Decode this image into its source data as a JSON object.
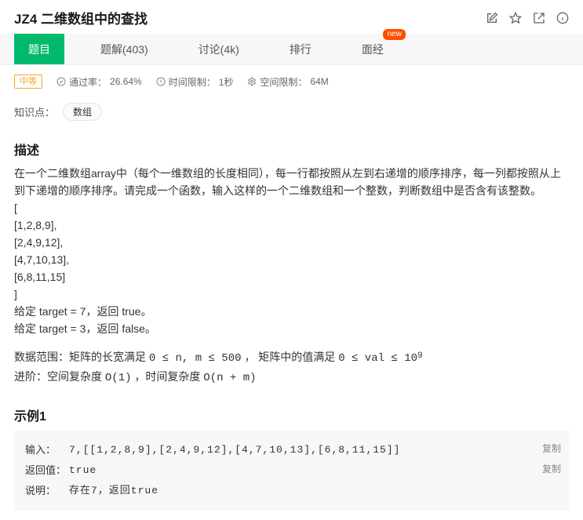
{
  "header": {
    "title": "JZ4 二维数组中的查找"
  },
  "tabs": {
    "problem": "题目",
    "solutions": "题解(403)",
    "discuss": "讨论(4k)",
    "rank": "排行",
    "interview": "面经",
    "new_badge": "new"
  },
  "meta": {
    "difficulty": "中等",
    "pass_rate_label": "通过率：",
    "pass_rate_value": "26.64%",
    "time_limit_label": "时间限制：",
    "time_limit_value": "1秒",
    "mem_limit_label": "空间限制：",
    "mem_limit_value": "64M"
  },
  "kp": {
    "label": "知识点：",
    "tag": "数组"
  },
  "description": {
    "heading": "描述",
    "para": "在一个二维数组array中（每个一维数组的长度相同），每一行都按照从左到右递增的顺序排序，每一列都按照从上到下递增的顺序排序。请完成一个函数，输入这样的一个二维数组和一个整数，判断数组中是否含有该整数。",
    "matrix_lines": [
      "[",
      "[1,2,8,9],",
      "[2,4,9,12],",
      "[4,7,10,13],",
      "[6,8,11,15]",
      "]"
    ],
    "target_line1": "给定 target = 7，返回 true。",
    "target_line2": "给定 target = 3，返回 false。",
    "range_prefix": "数据范围：矩阵的长宽满足 ",
    "range_eq1": "0 ≤ n, m ≤ 500",
    "range_mid": " ， 矩阵中的值满足 ",
    "range_eq2_base": "0 ≤ val ≤ 10",
    "range_eq2_sup": "9",
    "adv_prefix": "进阶：空间复杂度 ",
    "adv_o1": "O(1)",
    "adv_mid": " ，时间复杂度 ",
    "adv_onm": "O(n + m)"
  },
  "example": {
    "heading": "示例1",
    "input_label": "输入：",
    "input_value": "7,[[1,2,8,9],[2,4,9,12],[4,7,10,13],[6,8,11,15]]",
    "return_label": "返回值：",
    "return_value": "true",
    "explain_label": "说明：",
    "explain_value": "存在7，返回true",
    "copy": "复制"
  }
}
